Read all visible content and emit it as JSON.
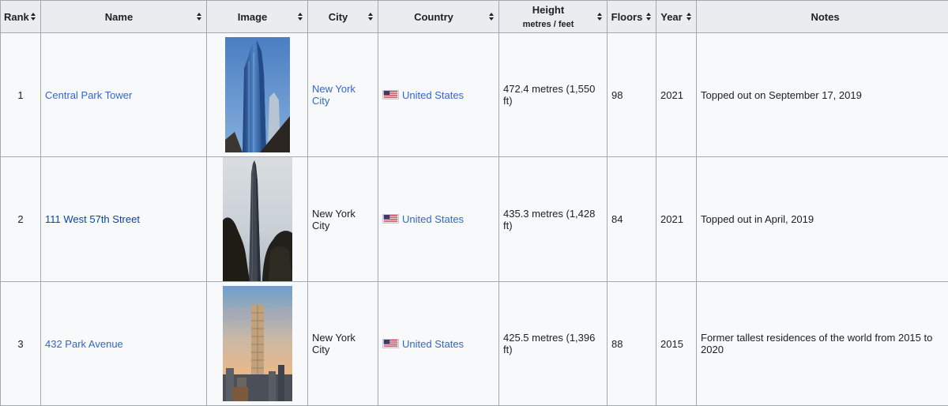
{
  "headers": {
    "rank": "Rank",
    "name": "Name",
    "image": "Image",
    "city": "City",
    "country": "Country",
    "height": "Height",
    "height_units": "metres / feet",
    "floors": "Floors",
    "year": "Year",
    "notes": "Notes"
  },
  "rows": [
    {
      "rank": "1",
      "name": "Central Park Tower",
      "image_icon": "skyscraper-photo",
      "city": "New York City",
      "country": "United States",
      "flag_icon": "us-flag-icon",
      "height": "472.4 metres (1,550 ft)",
      "floors": "98",
      "year": "2021",
      "notes": "Topped out on September 17, 2019"
    },
    {
      "rank": "2",
      "name": "111 West 57th Street",
      "image_icon": "skyscraper-photo",
      "city": "New York City",
      "country": "United States",
      "flag_icon": "us-flag-icon",
      "height": "435.3 metres (1,428 ft)",
      "floors": "84",
      "year": "2021",
      "notes": "Topped out in April, 2019"
    },
    {
      "rank": "3",
      "name": "432 Park Avenue",
      "image_icon": "skyscraper-photo",
      "city": "New York City",
      "country": "United States",
      "flag_icon": "us-flag-icon",
      "height": "425.5 metres (1,396 ft)",
      "floors": "88",
      "year": "2015",
      "notes": "Former tallest residences of the world from 2015 to 2020"
    }
  ],
  "colors": {
    "link": "#3366cc",
    "visited_link": "#0645ad",
    "header_bg": "#eaecf0",
    "cell_bg": "#f8f9fa",
    "border": "#a2a9b1"
  }
}
